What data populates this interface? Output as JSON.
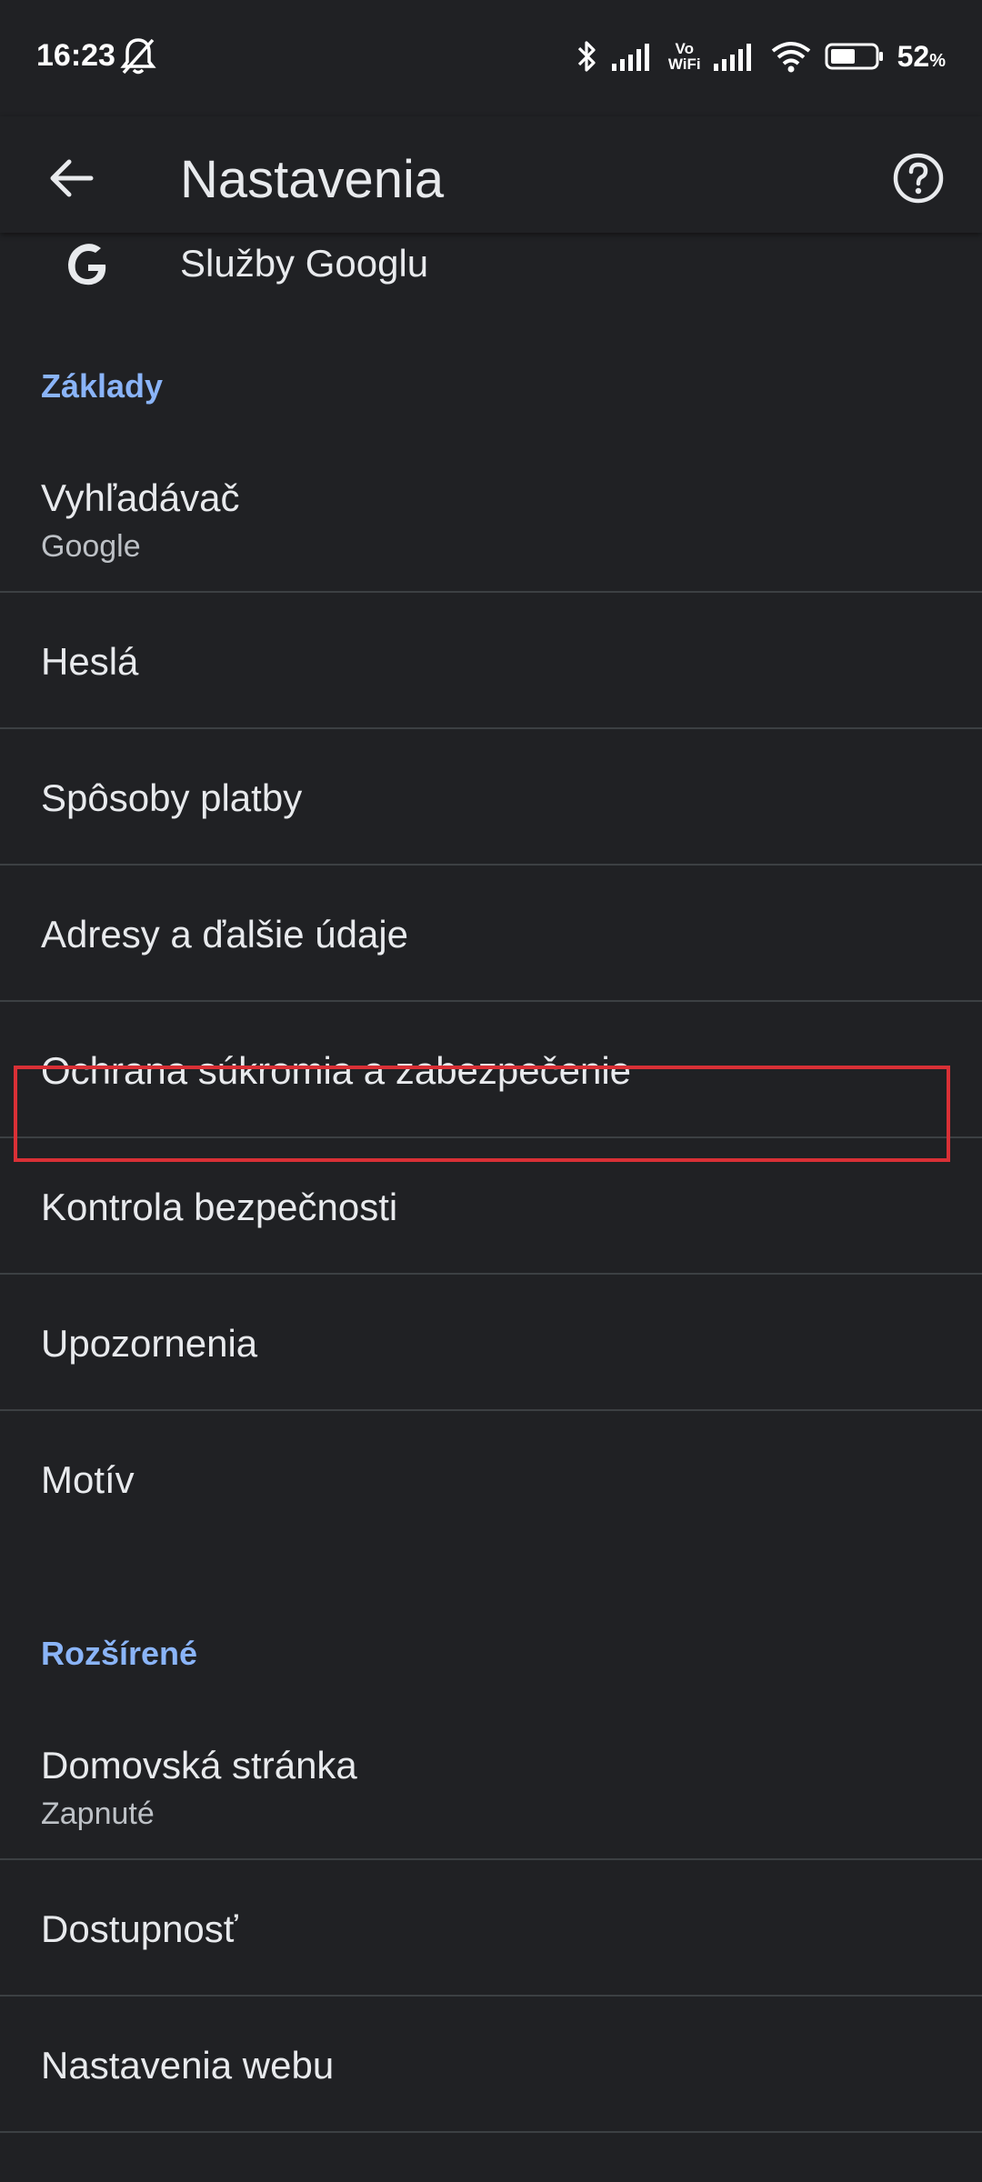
{
  "status_bar": {
    "time": "16:23",
    "battery_percent": "52",
    "battery_unit": "%",
    "vowifi_top": "Vo",
    "vowifi_bottom": "WiFi",
    "icons": [
      "bell-off-icon",
      "bluetooth-icon",
      "signal-icon",
      "vowifi-icon",
      "signal-icon",
      "wifi-icon",
      "battery-icon"
    ]
  },
  "toolbar": {
    "title": "Nastavenia",
    "back_icon": "arrow-back-icon",
    "help_icon": "help-circle-icon"
  },
  "google_services": {
    "label": "Služby Googlu",
    "icon": "google-g-icon"
  },
  "sections": {
    "basics": "Základy",
    "advanced": "Rozšírené"
  },
  "items": {
    "search_engine": {
      "title": "Vyhľadávač",
      "subtitle": "Google"
    },
    "passwords": {
      "title": "Heslá"
    },
    "payment": {
      "title": "Spôsoby platby"
    },
    "addresses": {
      "title": "Adresy a ďalšie údaje"
    },
    "privacy": {
      "title": "Ochrana súkromia a zabezpečenie"
    },
    "safety_check": {
      "title": "Kontrola bezpečnosti"
    },
    "notifications": {
      "title": "Upozornenia"
    },
    "theme": {
      "title": "Motív"
    },
    "homepage": {
      "title": "Domovská stránka",
      "subtitle": "Zapnuté"
    },
    "accessibility": {
      "title": "Dostupnosť"
    },
    "site_settings": {
      "title": "Nastavenia webu"
    }
  },
  "colors": {
    "background": "#202124",
    "accent": "#8ab4f8",
    "highlight": "#d93036",
    "divider": "#3c4043"
  }
}
